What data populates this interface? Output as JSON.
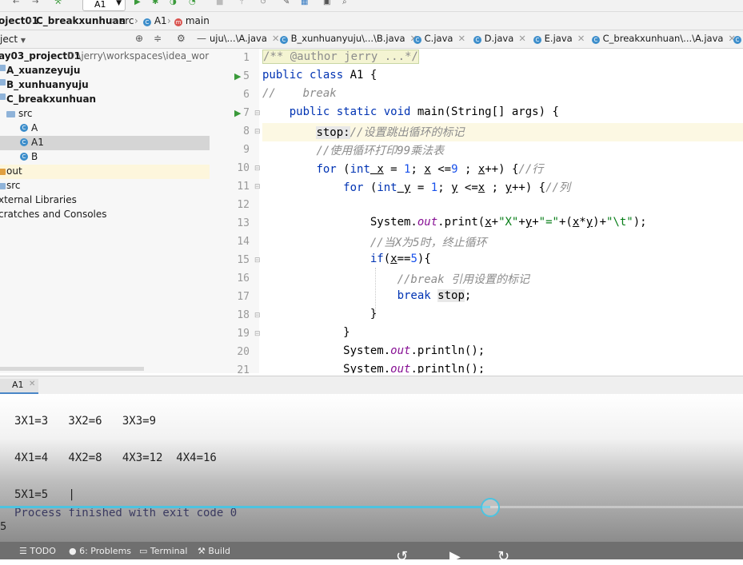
{
  "toolbar": {
    "run_config": "A1"
  },
  "breadcrumb": {
    "items": [
      "oject01",
      "C_breakxunhuan",
      "src",
      "A1",
      "main"
    ]
  },
  "project_panel": {
    "header": "ject",
    "items": [
      {
        "label": "ay03_project01",
        "path": "D:\\jerry\\workspaces\\idea_workspa"
      },
      {
        "label": "A_xuanzeyuju"
      },
      {
        "label": "B_xunhuanyuju"
      },
      {
        "label": "C_breakxunhuan"
      },
      {
        "label": "src"
      },
      {
        "label": "A"
      },
      {
        "label": "A1"
      },
      {
        "label": "B"
      },
      {
        "label": "out"
      },
      {
        "label": "src"
      },
      {
        "label": "xternal Libraries"
      },
      {
        "label": "cratches and Consoles"
      }
    ]
  },
  "tabs": [
    {
      "label": "uju\\...\\A.java"
    },
    {
      "label": "B_xunhuanyuju\\...\\B.java"
    },
    {
      "label": "C.java"
    },
    {
      "label": "D.java"
    },
    {
      "label": "E.java"
    },
    {
      "label": "C_breakxunhuan\\...\\A.java"
    }
  ],
  "editor": {
    "line_numbers": [
      "1",
      "5",
      "6",
      "7",
      "8",
      "9",
      "10",
      "11",
      "12",
      "13",
      "14",
      "15",
      "16",
      "17",
      "18",
      "19",
      "20",
      "21"
    ],
    "lines": {
      "l1": "/** @author jerry ...*/",
      "l5_kw": "public class",
      "l5_rest": " A1 {",
      "l6": "//    break",
      "l7_kw": "public static void",
      "l7_rest": " main(String[] args) {",
      "l8_label": "stop:",
      "l8_cm": "//设置跳出循环的标记",
      "l9": "//使用循环打印99乘法表",
      "l10_for": "for",
      "l10_int": "int",
      "l10_a": " x",
      "l10_b": " = ",
      "l10_n1": "1",
      "l10_c": "; ",
      "l10_d": "x",
      "l10_e": " <=",
      "l10_n9": "9",
      "l10_f": " ; ",
      "l10_g": "x",
      "l10_h": "++) {",
      "l10_cm": "//行",
      "l11_for": "for",
      "l11_int": "int",
      "l11_a": " y",
      "l11_b": " = ",
      "l11_n1": "1",
      "l11_c": "; ",
      "l11_d": "y",
      "l11_e": " <=",
      "l11_f": "x",
      "l11_g": " ; ",
      "l11_h": "y",
      "l11_i": "++) {",
      "l11_cm": "//列",
      "l13_a": "System.",
      "l13_out": "out",
      "l13_b": ".print(",
      "l13_x": "x",
      "l13_c": "+",
      "l13_s1": "\"X\"",
      "l13_d": "+",
      "l13_y": "y",
      "l13_e": "+",
      "l13_s2": "\"=\"",
      "l13_f": "+(",
      "l13_g": "x",
      "l13_h": "*",
      "l13_i": "y",
      "l13_j": ")+",
      "l13_s3": "\"\\t\"",
      "l13_k": ");",
      "l14": "//当X为5时，终止循环",
      "l15_if": "if",
      "l15_a": "(",
      "l15_x": "x",
      "l15_b": "==",
      "l15_n": "5",
      "l15_c": "){",
      "l16": "//break 引用设置的标记",
      "l17_kw": "break",
      "l17_stop": "stop",
      "l17_end": ";",
      "l18": "}",
      "l19": "}",
      "l20_a": "System.",
      "l20_out": "out",
      "l20_b": ".println();",
      "l21_a": "System.",
      "l21_out": "out",
      "l21_b": ".println();"
    }
  },
  "run_panel": {
    "tab": "A1",
    "output": [
      "3X1=3   3X2=6   3X3=9",
      "4X1=4   4X2=8   4X3=12  4X4=16",
      "5X1=5   |",
      "Process finished with exit code 0"
    ],
    "side_number": "5"
  },
  "video_progress": 0.66,
  "statusbar": {
    "items": [
      "TODO",
      "6: Problems",
      "Terminal",
      "Build"
    ]
  }
}
